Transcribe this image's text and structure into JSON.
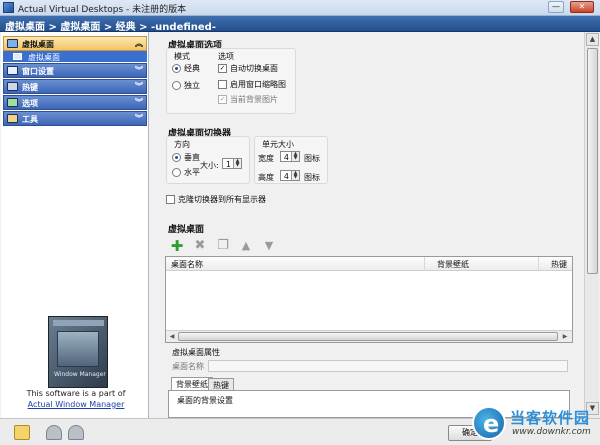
{
  "window": {
    "title": "Actual Virtual Desktops - 未注册的版本",
    "minimize": "—",
    "close": "✕"
  },
  "breadcrumb": "虚拟桌面 > 虚拟桌面 > 经典 > -undefined-",
  "sidebar": {
    "items": [
      {
        "label": "虚拟桌面",
        "icon": "desktop-icon"
      },
      {
        "label": "窗口设置",
        "icon": "window-icon"
      },
      {
        "label": "热键",
        "icon": "keyboard-icon"
      },
      {
        "label": "选项",
        "icon": "options-icon"
      },
      {
        "label": "工具",
        "icon": "tools-icon"
      }
    ],
    "subitem": "虚拟桌面",
    "chevron_up": "︽",
    "chevron_down": "︾",
    "promo_text": "This software is a part of",
    "promo_link": "Actual Window Manager",
    "box_text": "Window Manager"
  },
  "section1": {
    "title": "虚拟桌面选项",
    "mode_label": "模式",
    "mode_classic": "经典",
    "mode_independent": "独立",
    "options_label": "选项",
    "auto_switch": "自动切换桌面",
    "enable_thumbnails": "启用窗口缩略图",
    "current_bg": "当前背景图片"
  },
  "section2": {
    "title": "虚拟桌面切换器",
    "direction_label": "方向",
    "vertical": "垂直",
    "horizontal": "水平",
    "size_label": "大小:",
    "size_value": "1",
    "cell_size_label": "单元大小",
    "width_label": "宽度",
    "width_value": "4",
    "height_label": "高度",
    "height_value": "4",
    "icon_unit": "图标",
    "clone_switcher": "克隆切换器到所有显示器"
  },
  "section3": {
    "title": "虚拟桌面",
    "toolbar": {
      "add": "✚",
      "remove": "✖",
      "copy": "❐",
      "up": "▲",
      "down": "▼"
    },
    "columns": [
      "桌面名称",
      "背景壁纸",
      "热键"
    ],
    "properties_title": "虚拟桌面属性",
    "name_label": "桌面名称",
    "tabs": [
      "背景壁纸",
      "热键"
    ],
    "tab_content_label": "桌面的背景设置"
  },
  "footer": {
    "help_icon": "help-icon",
    "undo_icon": "undo-icon",
    "redo_icon": "redo-icon",
    "ok_label": "确定"
  },
  "watermark": {
    "brand": "当客软件园",
    "url": "www.downkr.com"
  },
  "colors": {
    "header_blue": "#234f8f",
    "nav_blue": "#3d66b8",
    "nav_active": "#f2c562",
    "add_green": "#2e9e2e"
  }
}
